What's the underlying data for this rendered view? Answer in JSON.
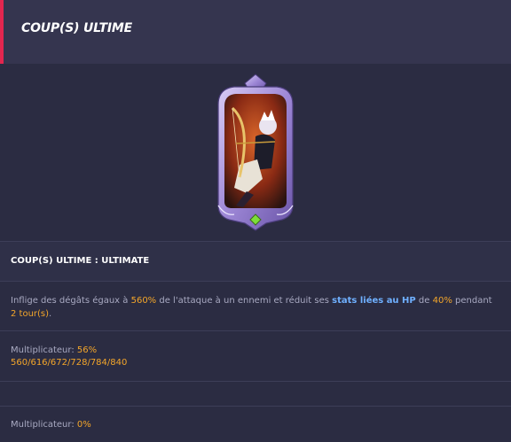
{
  "header": {
    "title": "COUP(S) ULTIME"
  },
  "skill": {
    "name": "COUP(S) ULTIME : ULTIMATE",
    "desc_p1": "Inflige des dégâts égaux à ",
    "desc_pct1": "560%",
    "desc_p2": " de l'attaque à un ennemi et réduit ses ",
    "desc_stat": "stats liées au HP",
    "desc_p3": " de ",
    "desc_pct2": "40%",
    "desc_p4": " pendant ",
    "desc_turns": "2 tour(s)",
    "desc_p5": "."
  },
  "multiplier1": {
    "label": "Multiplicateur: ",
    "value": "56%",
    "levels": "560/616/672/728/784/840"
  },
  "multiplier2": {
    "label": "Multiplicateur: ",
    "value": "0%"
  },
  "colors": {
    "accent": "#e3264f",
    "highlight_orange": "#f4a62a",
    "highlight_blue": "#6fb0ff",
    "background": "#2b2c42"
  }
}
